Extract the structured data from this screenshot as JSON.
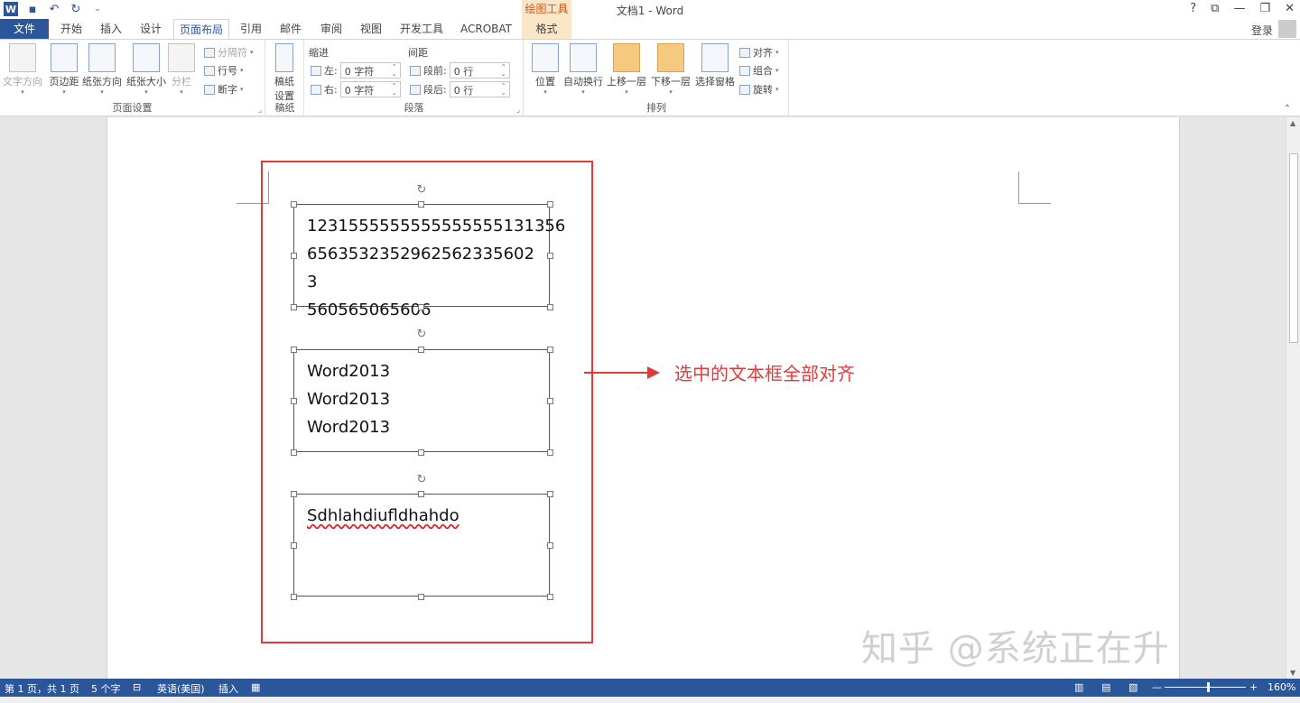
{
  "window": {
    "title": "文档1 - Word",
    "context_group": "绘图工具",
    "help": "?",
    "restore_ribbon": "⧉",
    "minimize": "—",
    "restore": "❐",
    "close": "✕"
  },
  "qat": {
    "undo": "↶",
    "redo": "↻",
    "customize": "⌄"
  },
  "tabs": {
    "file": "文件",
    "items": [
      "开始",
      "插入",
      "设计",
      "页面布局",
      "引用",
      "邮件",
      "审阅",
      "视图",
      "开发工具",
      "ACROBAT",
      "格式"
    ],
    "active": "页面布局",
    "login": "登录"
  },
  "ribbon": {
    "page_setup": {
      "label": "页面设置",
      "text_direction": "文字方向",
      "margins": "页边距",
      "orientation": "纸张方向",
      "size": "纸张大小",
      "columns": "分栏",
      "breaks": "分隔符",
      "line_numbers": "行号",
      "hyphenation": "断字"
    },
    "manuscript": {
      "label": "稿纸",
      "button": "稿纸\n设置"
    },
    "paragraph": {
      "label": "段落",
      "indent_header": "缩进",
      "spacing_header": "间距",
      "left_label": "左:",
      "left_value": "0 字符",
      "right_label": "右:",
      "right_value": "0 字符",
      "before_label": "段前:",
      "before_value": "0 行",
      "after_label": "段后:",
      "after_value": "0 行"
    },
    "arrange": {
      "label": "排列",
      "position": "位置",
      "wrap": "自动换行",
      "bring_forward": "上移一层",
      "send_backward": "下移一层",
      "selection_pane": "选择窗格",
      "align": "对齐",
      "group": "组合",
      "rotate": "旋转"
    }
  },
  "document": {
    "textbox1": [
      "1231555555555555555131356",
      "6563532352962562335602 3",
      "560565065606"
    ],
    "textbox2": [
      "Word2013",
      "Word2013",
      "Word2013"
    ],
    "textbox3": [
      "Sdhlahdiufldhahdo"
    ],
    "annotation": "选中的文本框全部对齐",
    "watermark": "知乎 @系统正在升级ing"
  },
  "status": {
    "page": "第 1 页，共 1 页",
    "words": "5 个字",
    "language": "英语(美国)",
    "mode": "插入",
    "zoom": "160%",
    "zoom_minus": "—",
    "zoom_plus": "+"
  }
}
